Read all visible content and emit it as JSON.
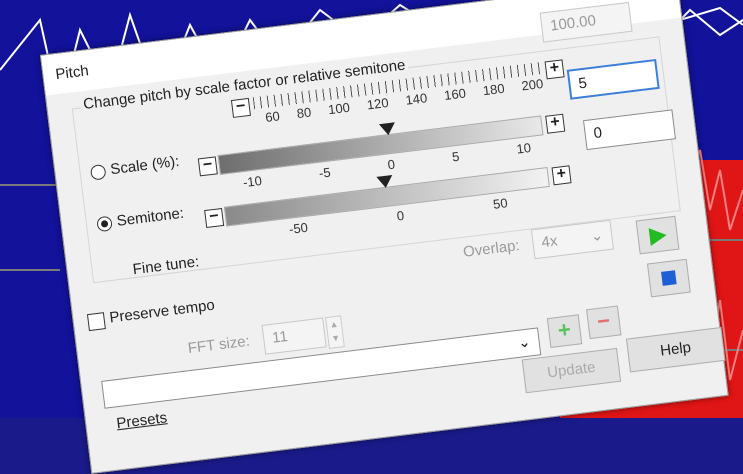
{
  "dialog": {
    "title": "Pitch"
  },
  "group": {
    "caption": "Change pitch by scale factor or relative semitone",
    "scale_label": "Scale (%):",
    "semitone_label": "Semitone:",
    "finetune_label": "Fine tune:",
    "scale_ticks": [
      "60",
      "80",
      "100",
      "120",
      "140",
      "160",
      "180",
      "200"
    ],
    "semitone_ticks": [
      "-10",
      "-5",
      "0",
      "5",
      "10"
    ],
    "finetune_ticks": [
      "-50",
      "0",
      "50"
    ],
    "selected_mode": "semitone"
  },
  "fields": {
    "scale_value": "100.00",
    "semitone_value": "5",
    "finetune_value": "0"
  },
  "options": {
    "overlap_label": "Overlap:",
    "overlap_value": "4x",
    "preserve_tempo_label": "Preserve tempo",
    "preserve_tempo_checked": false,
    "fft_label": "FFT size:",
    "fft_value": "11"
  },
  "presets": {
    "label": "Presets",
    "update_label": "Update",
    "help_label": "Help"
  },
  "colors": {
    "play": "#22bb22",
    "stop": "#1f5fd6",
    "add": "#5cc05c",
    "remove": "#e07070"
  }
}
